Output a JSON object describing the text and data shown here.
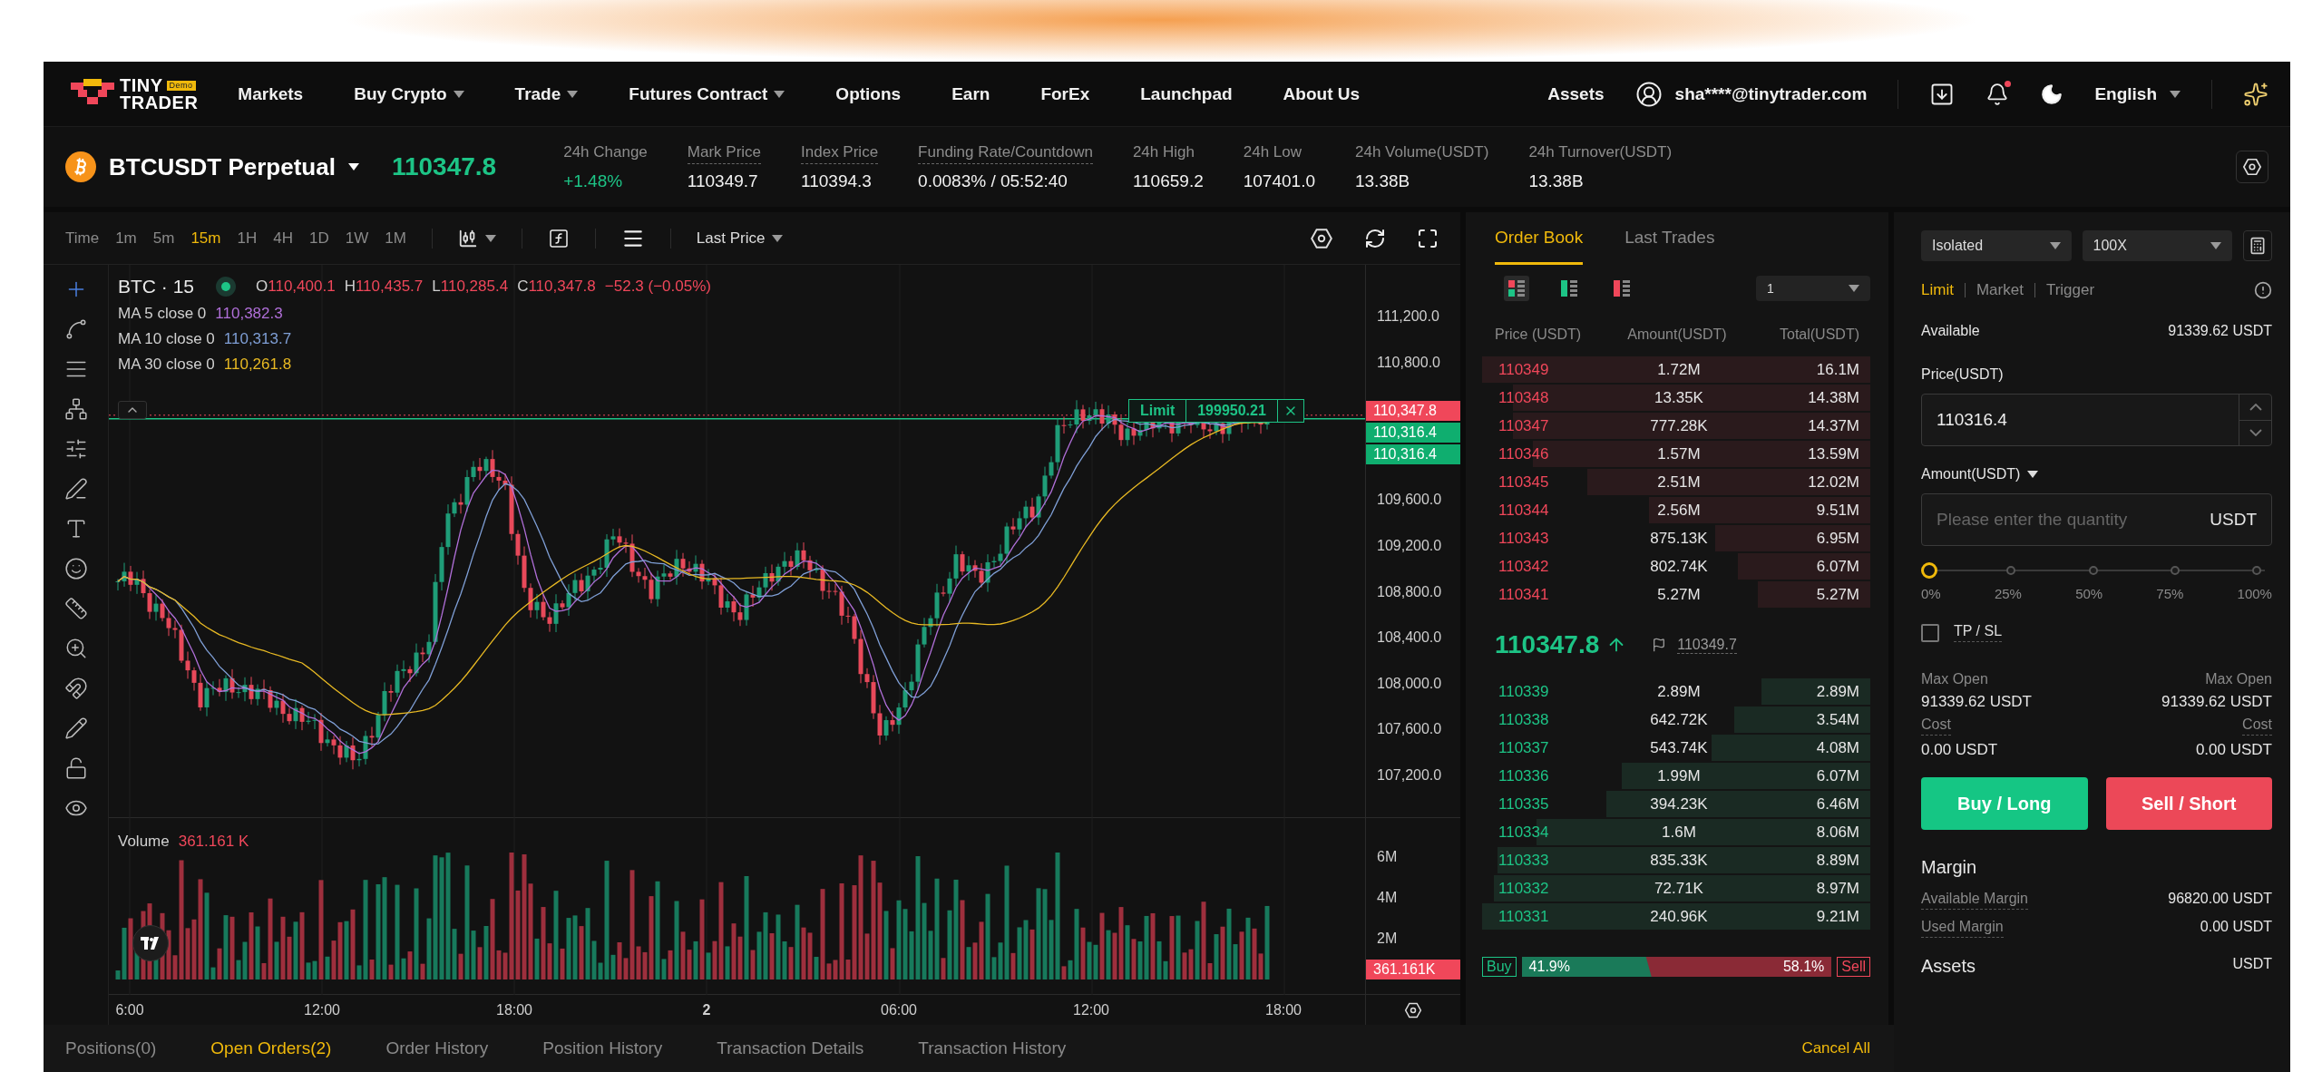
{
  "nav": {
    "logo_top": "TINY",
    "logo_bottom": "TRADER",
    "logo_badge": "Demo",
    "items": [
      {
        "label": "Markets",
        "dropdown": false
      },
      {
        "label": "Buy Crypto",
        "dropdown": true
      },
      {
        "label": "Trade",
        "dropdown": true
      },
      {
        "label": "Futures Contract",
        "dropdown": true
      },
      {
        "label": "Options",
        "dropdown": false
      },
      {
        "label": "Earn",
        "dropdown": false
      },
      {
        "label": "ForEx",
        "dropdown": false
      },
      {
        "label": "Launchpad",
        "dropdown": false
      },
      {
        "label": "About Us",
        "dropdown": false
      }
    ],
    "assets": "Assets",
    "user_email": "sha****@tinytrader.com",
    "unread_notifications": true,
    "language": "English"
  },
  "ticker": {
    "symbol": "BTCUSDT Perpetual",
    "price": "110347.8",
    "stats": [
      {
        "label": "24h Change",
        "value": "+1.48%",
        "kind": "up",
        "underlined": false
      },
      {
        "label": "Mark Price",
        "value": "110349.7",
        "kind": "plain",
        "underlined": true
      },
      {
        "label": "Index Price",
        "value": "110394.3",
        "kind": "plain",
        "underlined": true
      },
      {
        "label": "Funding Rate/Countdown",
        "value": "0.0083% / 05:52:40",
        "kind": "plain",
        "underlined": true
      },
      {
        "label": "24h High",
        "value": "110659.2",
        "kind": "plain",
        "underlined": false
      },
      {
        "label": "24h Low",
        "value": "107401.0",
        "kind": "plain",
        "underlined": false
      },
      {
        "label": "24h Volume(USDT)",
        "value": "13.38B",
        "kind": "plain",
        "underlined": false
      },
      {
        "label": "24h Turnover(USDT)",
        "value": "13.38B",
        "kind": "plain",
        "underlined": false
      }
    ]
  },
  "chart": {
    "timeframes": [
      {
        "label": "Time",
        "selected": false
      },
      {
        "label": "1m",
        "selected": false
      },
      {
        "label": "5m",
        "selected": false
      },
      {
        "label": "15m",
        "selected": true
      },
      {
        "label": "1H",
        "selected": false
      },
      {
        "label": "4H",
        "selected": false
      },
      {
        "label": "1D",
        "selected": false
      },
      {
        "label": "1W",
        "selected": false
      },
      {
        "label": "1M",
        "selected": false
      }
    ],
    "price_type": "Last Price",
    "symbol": "BTC · 15",
    "ohlc": [
      {
        "key": "O",
        "value": "110,400.1"
      },
      {
        "key": "H",
        "value": "110,435.7"
      },
      {
        "key": "L",
        "value": "110,285.4"
      },
      {
        "key": "C",
        "value": "110,347.8"
      }
    ],
    "change": "−52.3 (−0.05%)",
    "moving_averages": [
      {
        "label": "MA 5 close 0",
        "value": "110,382.3",
        "color": "#b06fd8"
      },
      {
        "label": "MA 10 close 0",
        "value": "110,313.7",
        "color": "#7f9fd6"
      },
      {
        "label": "MA 30 close 0",
        "value": "110,261.8",
        "color": "#e8b923"
      }
    ],
    "price_ticks": [
      "111,200.0",
      "110,800.0",
      "109,600.0",
      "109,200.0",
      "108,800.0",
      "108,400.0",
      "108,000.0",
      "107,600.0",
      "107,200.0"
    ],
    "price_tags": [
      {
        "label": "110,347.8",
        "kind": "down"
      },
      {
        "label": "110,316.4",
        "kind": "up"
      },
      {
        "label": "110,316.4",
        "kind": "up"
      }
    ],
    "open_order": {
      "type": "Limit",
      "amount": "199950.21"
    },
    "volume_label": "Volume",
    "volume_value": "361.161 K",
    "volume_ticks": [
      "6M",
      "4M",
      "2M"
    ],
    "volume_tag": "361.161K",
    "time_labels": [
      "6:00",
      "12:00",
      "18:00",
      "2",
      "06:00",
      "12:00",
      "18:00"
    ]
  },
  "order_book": {
    "tabs": [
      {
        "label": "Order Book",
        "selected": true
      },
      {
        "label": "Last Trades",
        "selected": false
      }
    ],
    "precision": "1",
    "columns": [
      "Price (USDT)",
      "Amount(USDT)",
      "Total(USDT)"
    ],
    "asks": [
      {
        "price": "110349",
        "amount": "1.72M",
        "total": "16.1M",
        "level": 1.0
      },
      {
        "price": "110348",
        "amount": "13.35K",
        "total": "14.38M",
        "level": 0.92
      },
      {
        "price": "110347",
        "amount": "777.28K",
        "total": "14.37M",
        "level": 0.92
      },
      {
        "price": "110346",
        "amount": "1.57M",
        "total": "13.59M",
        "level": 0.87
      },
      {
        "price": "110345",
        "amount": "2.51M",
        "total": "12.02M",
        "level": 0.73
      },
      {
        "price": "110344",
        "amount": "2.56M",
        "total": "9.51M",
        "level": 0.57
      },
      {
        "price": "110343",
        "amount": "875.13K",
        "total": "6.95M",
        "level": 0.4
      },
      {
        "price": "110342",
        "amount": "802.74K",
        "total": "6.07M",
        "level": 0.34
      },
      {
        "price": "110341",
        "amount": "5.27M",
        "total": "5.27M",
        "level": 0.29
      }
    ],
    "last_price": "110347.8",
    "mark_price": "110349.7",
    "bids": [
      {
        "price": "110339",
        "amount": "2.89M",
        "total": "2.89M",
        "level": 0.28
      },
      {
        "price": "110338",
        "amount": "642.72K",
        "total": "3.54M",
        "level": 0.35
      },
      {
        "price": "110337",
        "amount": "543.74K",
        "total": "4.08M",
        "level": 0.41
      },
      {
        "price": "110336",
        "amount": "1.99M",
        "total": "6.07M",
        "level": 0.64
      },
      {
        "price": "110335",
        "amount": "394.23K",
        "total": "6.46M",
        "level": 0.68
      },
      {
        "price": "110334",
        "amount": "1.6M",
        "total": "8.06M",
        "level": 0.86
      },
      {
        "price": "110333",
        "amount": "835.33K",
        "total": "8.89M",
        "level": 0.96
      },
      {
        "price": "110332",
        "amount": "72.71K",
        "total": "8.97M",
        "level": 0.97
      },
      {
        "price": "110331",
        "amount": "240.96K",
        "total": "9.21M",
        "level": 1.0
      }
    ],
    "ratio": {
      "buy_label": "Buy",
      "buy_pct": "41.9%",
      "sell_pct": "58.1%",
      "sell_label": "Sell",
      "level": 0.419
    }
  },
  "order_form": {
    "margin_mode": "Isolated",
    "leverage": "100X",
    "order_types": [
      {
        "label": "Limit",
        "selected": true
      },
      {
        "label": "Market",
        "selected": false
      },
      {
        "label": "Trigger",
        "selected": false
      }
    ],
    "available_label": "Available",
    "available_value": "91339.62 USDT",
    "price_label": "Price(USDT)",
    "price_value": "110316.4",
    "amount_label": "Amount(USDT)",
    "amount_placeholder": "Please enter the quantity",
    "amount_unit": "USDT",
    "slider": {
      "level": 0,
      "labels": [
        "0%",
        "25%",
        "50%",
        "75%",
        "100%"
      ]
    },
    "tpsl": {
      "label": "TP / SL",
      "checked": false
    },
    "buy_side": {
      "max_label": "Max Open",
      "max_value": "91339.62 USDT",
      "cost_label": "Cost",
      "cost_value": "0.00 USDT"
    },
    "sell_side": {
      "max_label": "Max Open",
      "max_value": "91339.62 USDT",
      "cost_label": "Cost",
      "cost_value": "0.00 USDT"
    },
    "buy_button": "Buy / Long",
    "sell_button": "Sell / Short",
    "margin_title": "Margin",
    "margin_rows": [
      {
        "label": "Available Margin",
        "value": "96820.00 USDT"
      },
      {
        "label": "Used Margin",
        "value": "0.00 USDT"
      }
    ],
    "assets_title": "Assets",
    "assets_unit": "USDT"
  },
  "bottom_tabs": {
    "tabs": [
      {
        "label": "Positions(0)",
        "selected": false
      },
      {
        "label": "Open Orders(2)",
        "selected": true
      },
      {
        "label": "Order History",
        "selected": false
      },
      {
        "label": "Position History",
        "selected": false
      },
      {
        "label": "Transaction Details",
        "selected": false
      },
      {
        "label": "Transaction History",
        "selected": false
      }
    ],
    "cancel_all": "Cancel All"
  }
}
